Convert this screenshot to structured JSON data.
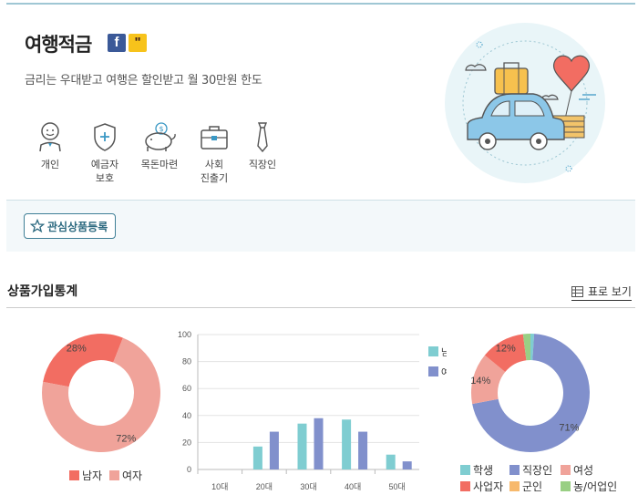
{
  "product": {
    "title": "여행적금",
    "subtitle": "금리는 우대받고 여행은 할인받고 월 30만원 한도",
    "share": {
      "facebook": "f",
      "kakao": "\""
    },
    "tags": [
      {
        "icon": "person-icon",
        "lines": [
          "개인"
        ]
      },
      {
        "icon": "shield-icon",
        "lines": [
          "예금자",
          "보호"
        ]
      },
      {
        "icon": "piggy-bank-icon",
        "lines": [
          "목돈마련"
        ]
      },
      {
        "icon": "briefcase-icon",
        "lines": [
          "사회",
          "진출기"
        ]
      },
      {
        "icon": "necktie-icon",
        "lines": [
          "직장인"
        ]
      }
    ]
  },
  "favorite_button": "관심상품등록",
  "stats": {
    "title": "상품가입통계",
    "table_view": "표로 보기"
  },
  "colors": {
    "teal": "#7fcdd1",
    "blue": "#8190cc",
    "salmon": "#f0a39a",
    "red": "#f26d62",
    "orange": "#f7b96c",
    "green": "#99cf84",
    "accent": "#2d6a80"
  },
  "chart_data": [
    {
      "type": "pie",
      "title": "",
      "series": [
        {
          "name": "남자",
          "value": 28,
          "label": "28%",
          "color": "#f26d62"
        },
        {
          "name": "여자",
          "value": 72,
          "label": "72%",
          "color": "#f0a39a"
        }
      ],
      "legend": "bottom"
    },
    {
      "type": "bar",
      "categories": [
        "10대",
        "20대",
        "30대",
        "40대",
        "50대"
      ],
      "series": [
        {
          "name": "남",
          "values": [
            0,
            17,
            34,
            37,
            11
          ],
          "color": "#7fcdd1"
        },
        {
          "name": "여",
          "values": [
            0,
            28,
            38,
            28,
            6
          ],
          "color": "#8190cc"
        }
      ],
      "yticks": [
        "0",
        "20",
        "40",
        "60",
        "80",
        "100"
      ],
      "ylim": [
        0,
        100
      ],
      "grid": true,
      "legend": "right"
    },
    {
      "type": "pie",
      "title": "",
      "series": [
        {
          "name": "학생",
          "value": 1,
          "label": "",
          "color": "#7fcdd1"
        },
        {
          "name": "직장인",
          "value": 71,
          "label": "71%",
          "color": "#8190cc"
        },
        {
          "name": "여성",
          "value": 14,
          "label": "14%",
          "color": "#f0a39a"
        },
        {
          "name": "사업자",
          "value": 12,
          "label": "12%",
          "color": "#f26d62"
        },
        {
          "name": "군인",
          "value": 0,
          "label": "",
          "color": "#f7b96c"
        },
        {
          "name": "농/어업인",
          "value": 2,
          "label": "",
          "color": "#99cf84"
        }
      ],
      "legend": "bottom"
    }
  ]
}
